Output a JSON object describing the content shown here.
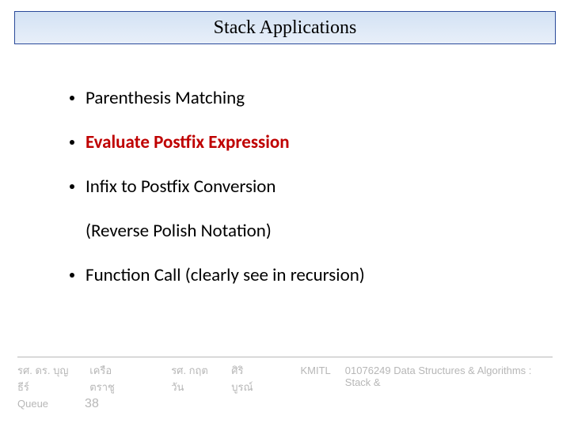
{
  "title": "Stack Applications",
  "bullets": {
    "b1": "Parenthesis Matching",
    "b2": "Evaluate Postfix Expression",
    "b3": "Infix to Postfix Conversion",
    "b3_sub": "(Reverse Polish Notation)",
    "b4": "Function Call (clearly see in recursion)"
  },
  "footer": {
    "author1": "รศ. ดร. บุญธีร์",
    "author1b": "เครือตราชู",
    "author2": "รศ. กฤตวัน",
    "author2b": "ศิริบูรณ์",
    "inst": "KMITL",
    "course": "01076249 Data Structures & Algorithms : Stack &",
    "course2": "Queue",
    "page": "38"
  }
}
